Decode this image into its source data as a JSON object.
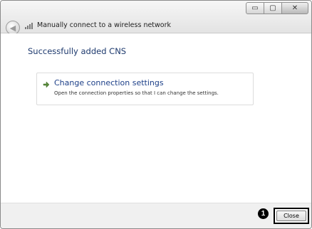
{
  "window": {
    "title": "Manually connect to a wireless network",
    "controls": {
      "minimize": "▭",
      "maximize": "▢",
      "close": "✕"
    }
  },
  "main": {
    "heading": "Successfully added CNS",
    "option": {
      "title": "Change connection settings",
      "description": "Open the connection properties so that I can change the settings."
    }
  },
  "footer": {
    "callout_number": "1",
    "close_label": "Close"
  },
  "icons": {
    "back": "back-arrow-icon",
    "signal": "wireless-network-icon",
    "option_arrow": "arrow-right-icon"
  }
}
